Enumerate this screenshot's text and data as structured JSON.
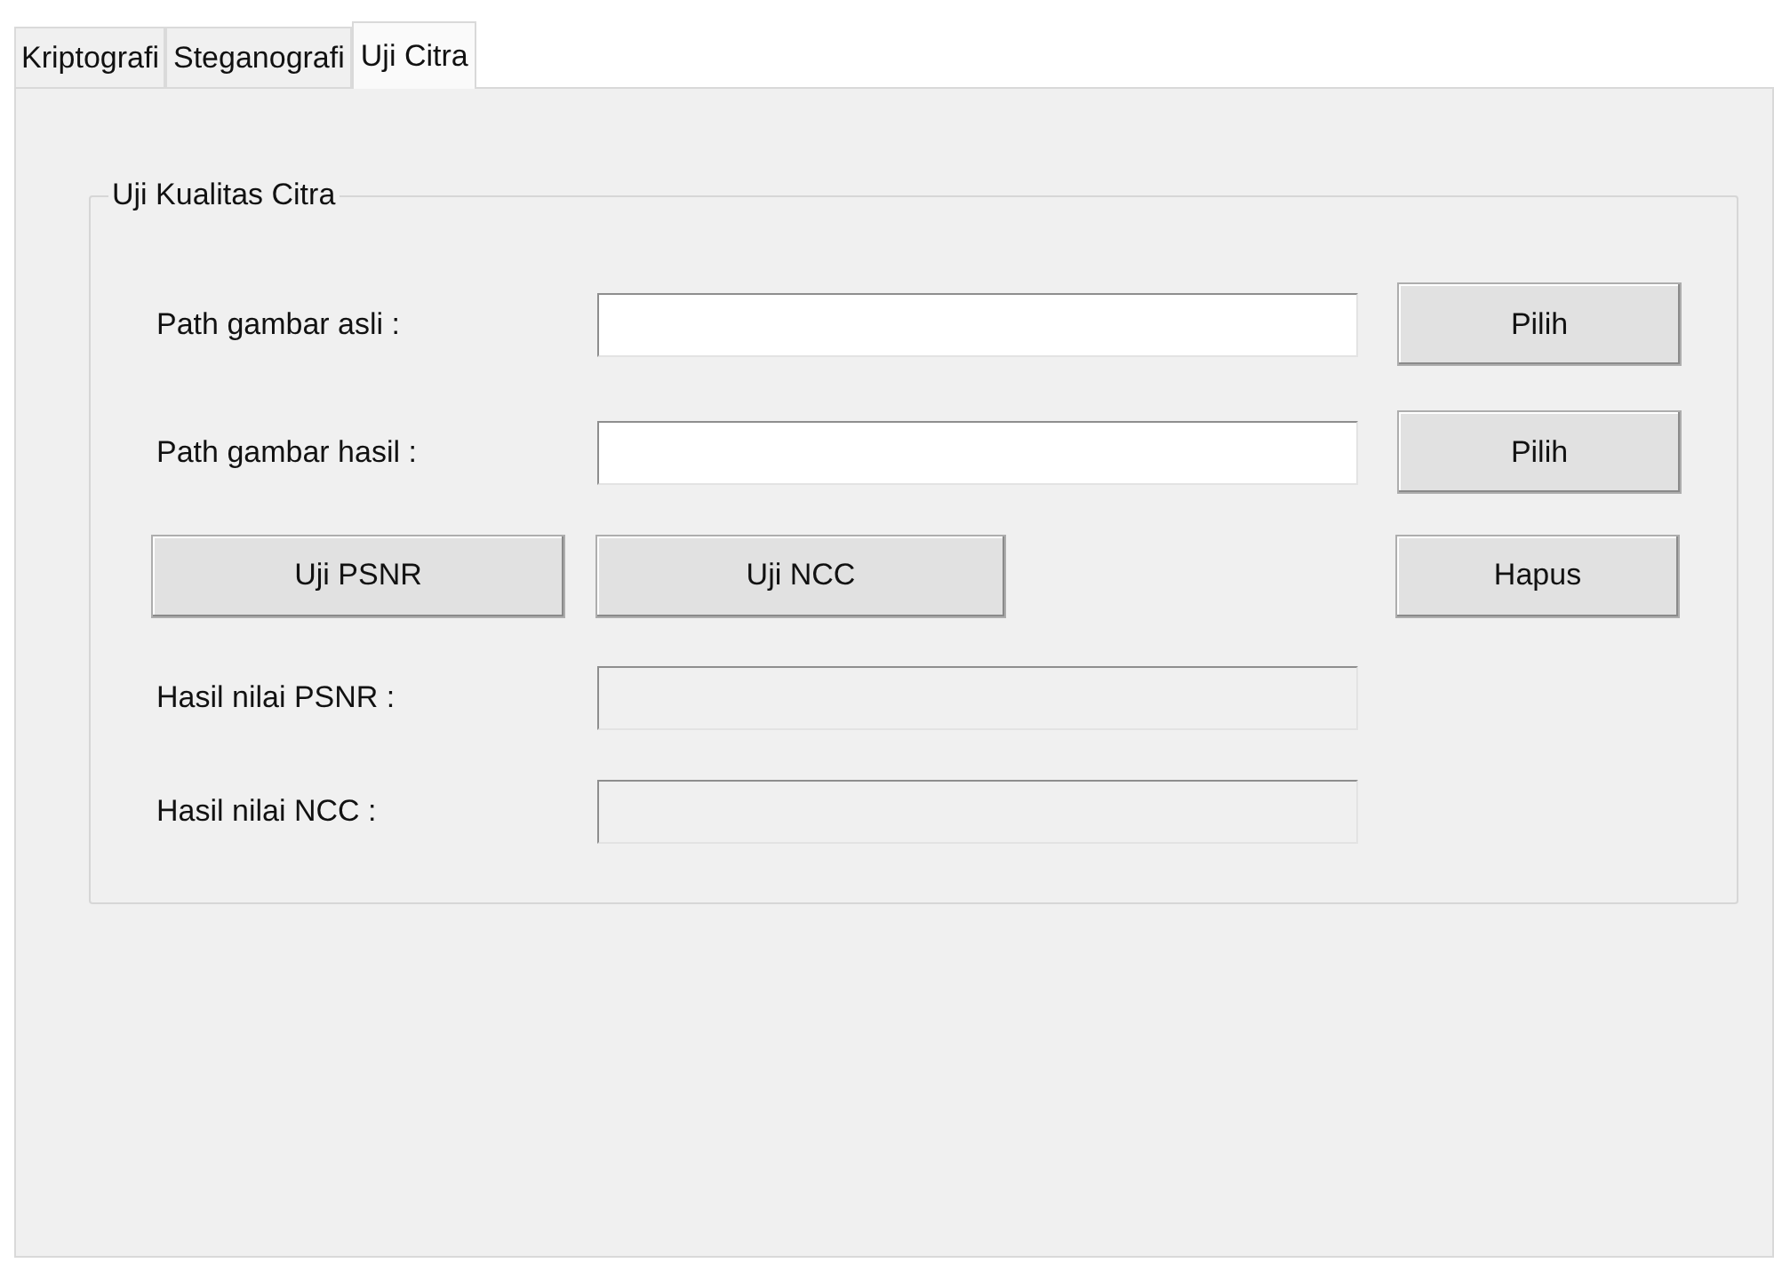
{
  "tabs": [
    {
      "label": "Kriptografi",
      "selected": false
    },
    {
      "label": "Steganografi",
      "selected": false
    },
    {
      "label": "Uji Citra",
      "selected": true
    }
  ],
  "group": {
    "title": "Uji Kualitas Citra",
    "path_fields": [
      {
        "label": "Path gambar asli :",
        "button": "Pilih"
      },
      {
        "label": "Path gambar hasil :",
        "button": "Pilih"
      }
    ],
    "test_buttons": [
      "Uji PSNR",
      "Uji NCC"
    ],
    "clear_button": "Hapus",
    "result_fields": [
      {
        "label": "Hasil nilai PSNR :",
        "disabled": true
      },
      {
        "label": "Hasil nilai NCC :",
        "disabled": true
      }
    ]
  }
}
